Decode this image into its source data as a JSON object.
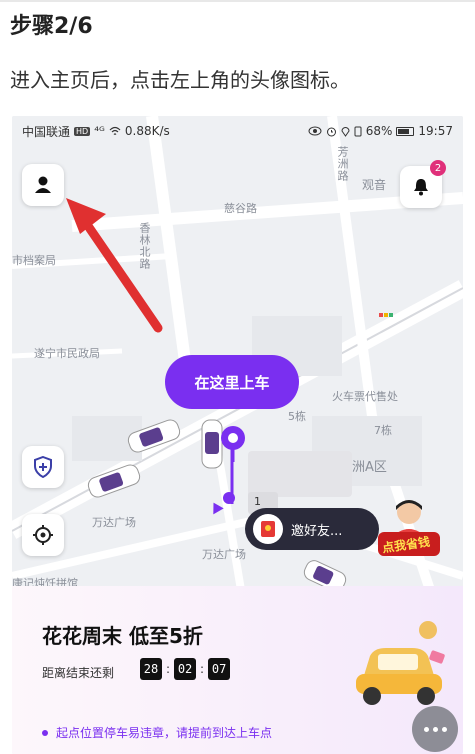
{
  "step": {
    "title": "步骤2/6",
    "description": "进入主页后，点击左上角的头像图标。"
  },
  "status_bar": {
    "carrier": "中国联通",
    "hd": "HD",
    "signal": "⁴ᴳ",
    "speed": "0.88K/s",
    "battery": "68%",
    "time": "19:57"
  },
  "map": {
    "labels": {
      "cixin_road": "慈谷路",
      "xianglin_north_road": "香林北路",
      "fangzhou_road": "芳洲路",
      "guanyin": "观音",
      "archives": "市档案局",
      "civil_affairs": "遂宁市民政局",
      "wanda_plaza_1": "万达广场",
      "wanda_plaza_2": "万达广场",
      "ticket_office": "火车票代售处",
      "building_5": "5栋",
      "building_7": "7栋",
      "zhou_a_district": "洲A区",
      "bottom_left": "康记炖饪拼馆",
      "pin_number": "1"
    },
    "board_button": "在这里上车",
    "invite_text": "邀好友...",
    "promo_badge": "点我省钱",
    "bell_badge": "2"
  },
  "bottom_card": {
    "promo_title": "花花周末 低至5折",
    "countdown_label": "距离结束还剩",
    "countdown": {
      "hours": "28",
      "minutes": "02",
      "seconds": "07"
    },
    "notice": "起点位置停车易违章，请提前到达上车点"
  },
  "colors": {
    "accent": "#7a2ff0",
    "arrow": "#e03030"
  }
}
